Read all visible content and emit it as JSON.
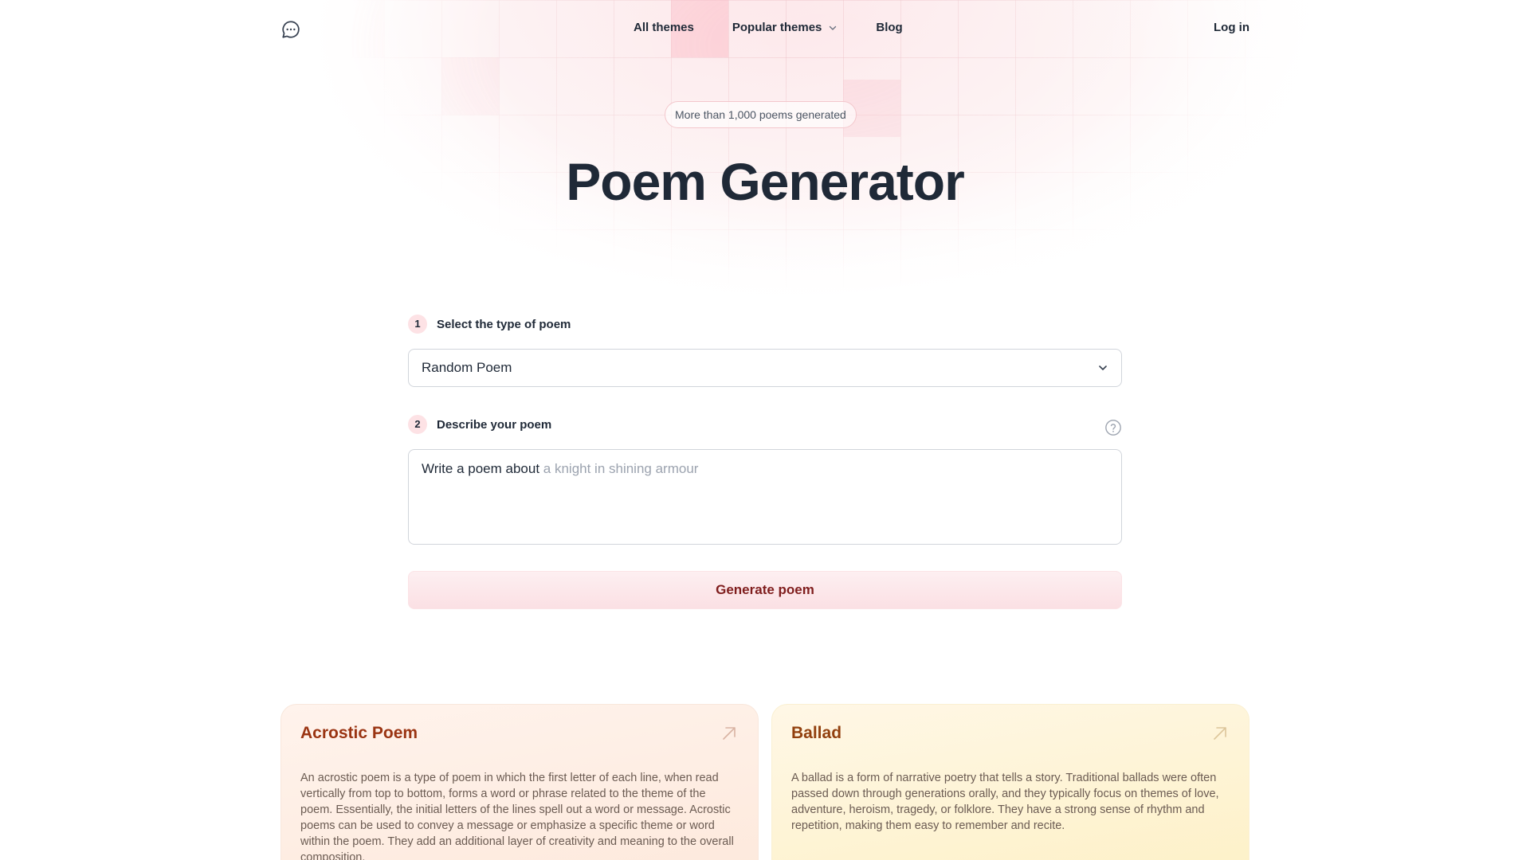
{
  "nav": {
    "logo_icon": "chat-bubble-icon",
    "links": [
      {
        "label": "All themes"
      },
      {
        "label": "Popular themes",
        "icon": "chevron-down-icon"
      },
      {
        "label": "Blog"
      }
    ],
    "login_label": "Log in"
  },
  "hero": {
    "badge": "More than 1,000 poems generated",
    "title": "Poem Generator"
  },
  "form": {
    "step1": {
      "number": "1",
      "label": "Select the type of poem"
    },
    "poem_type_value": "Random Poem",
    "step2": {
      "number": "2",
      "label": "Describe your poem"
    },
    "prompt_prefix": "Write a poem about",
    "prompt_placeholder": "a knight in shining armour",
    "generate_label": "Generate poem"
  },
  "cards": [
    {
      "title": "Acrostic Poem",
      "text": "An acrostic poem is a type of poem in which the first letter of each line, when read vertically from top to bottom, forms a word or phrase related to the theme of the poem. Essentially, the initial letters of the lines spell out a word or message. Acrostic poems can be used to convey a message or emphasize a specific theme or word within the poem. They add an additional layer of creativity and meaning to the overall composition."
    },
    {
      "title": "Ballad",
      "text": "A ballad is a form of narrative poetry that tells a story. Traditional ballads were often passed down through generations orally, and they typically focus on themes of love, adventure, heroism, tragedy, or folklore. They have a strong sense of rhythm and repetition, making them easy to remember and recite."
    }
  ],
  "colors": {
    "accent_pink": "#fde2e5",
    "generate_text": "#7f1d1d",
    "acrostic_title": "#9a3412",
    "ballad_title": "#92400e"
  }
}
